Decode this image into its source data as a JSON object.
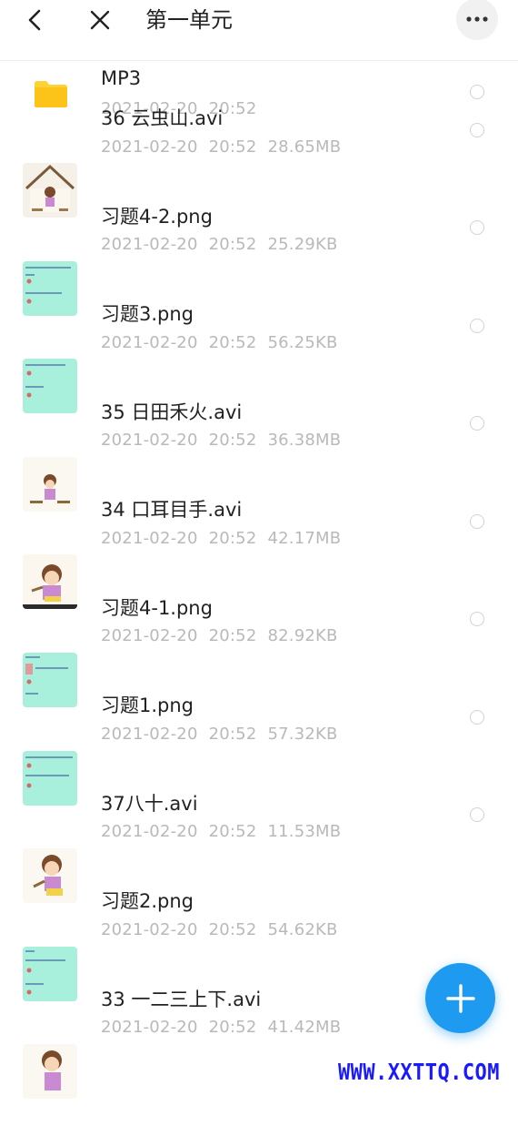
{
  "header": {
    "title": "第一单元",
    "back_icon": "chevron-left-icon",
    "close_icon": "close-icon",
    "more_icon": "more-dots-icon"
  },
  "files": [
    {
      "name": "MP3",
      "date": "2021-02-20",
      "time": "20:52",
      "size": "",
      "kind": "folder"
    },
    {
      "name": "36 云虫山.avi",
      "date": "2021-02-20",
      "time": "20:52",
      "size": "28.65MB",
      "kind": "video"
    },
    {
      "name": "习题4-2.png",
      "date": "2021-02-20",
      "time": "20:52",
      "size": "25.29KB",
      "kind": "image"
    },
    {
      "name": "习题3.png",
      "date": "2021-02-20",
      "time": "20:52",
      "size": "56.25KB",
      "kind": "image"
    },
    {
      "name": "35 日田禾火.avi",
      "date": "2021-02-20",
      "time": "20:52",
      "size": "36.38MB",
      "kind": "video"
    },
    {
      "name": "34 口耳目手.avi",
      "date": "2021-02-20",
      "time": "20:52",
      "size": "42.17MB",
      "kind": "video"
    },
    {
      "name": "习题4-1.png",
      "date": "2021-02-20",
      "time": "20:52",
      "size": "82.92KB",
      "kind": "image"
    },
    {
      "name": "习题1.png",
      "date": "2021-02-20",
      "time": "20:52",
      "size": "57.32KB",
      "kind": "image"
    },
    {
      "name": "37八十.avi",
      "date": "2021-02-20",
      "time": "20:52",
      "size": "11.53MB",
      "kind": "video"
    },
    {
      "name": "习题2.png",
      "date": "2021-02-20",
      "time": "20:52",
      "size": "54.62KB",
      "kind": "image"
    },
    {
      "name": "33 一二三上下.avi",
      "date": "2021-02-20",
      "time": "20:52",
      "size": "41.42MB",
      "kind": "video"
    }
  ],
  "fab": {
    "icon": "plus-icon"
  },
  "watermark": "WWW.XXTTQ.COM",
  "colors": {
    "accent": "#1e9bf0",
    "folder": "#fdd235",
    "image_thumb": "#a8f0dc",
    "watermark": "#1a1aff"
  }
}
